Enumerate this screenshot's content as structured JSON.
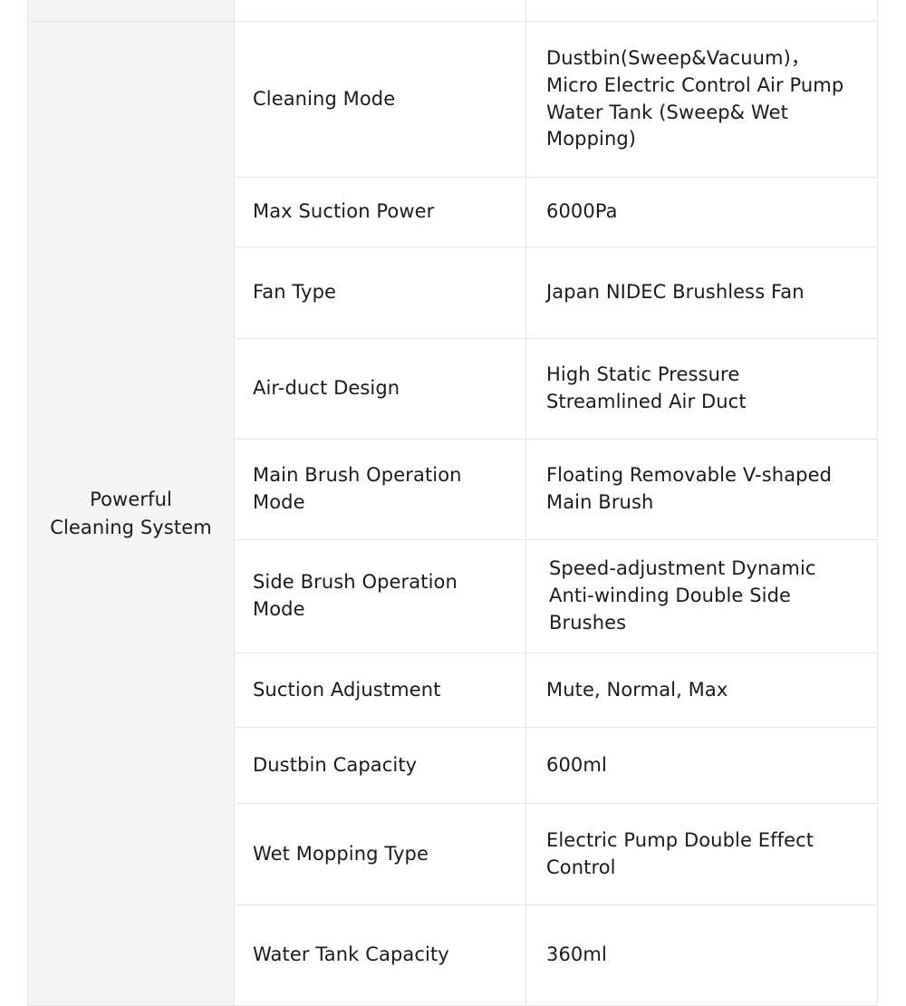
{
  "table": {
    "category": {
      "label": "Powerful\nCleaning System",
      "line1": "Powerful",
      "line2": "Cleaning System"
    },
    "rows": [
      {
        "label": "Cleaning Mode",
        "value": "Dustbin(Sweep&Vacuum)，Micro Electric Control Air Pump Water Tank (Sweep& Wet Mopping)"
      },
      {
        "label": "Max Suction Power",
        "value": "6000Pa"
      },
      {
        "label": "Fan Type",
        "value": "Japan NIDEC Brushless Fan"
      },
      {
        "label": "Air-duct Design",
        "value": "High Static Pressure Streamlined Air Duct"
      },
      {
        "label": "Main Brush Operation Mode",
        "value": "Floating Removable V-shaped Main Brush"
      },
      {
        "label": "Side Brush Operation Mode",
        "value": "Speed-adjustment Dynamic Anti-winding Double Side Brushes"
      },
      {
        "label": "Suction Adjustment",
        "value": "Mute, Normal, Max"
      },
      {
        "label": "Dustbin Capacity",
        "value": "600ml"
      },
      {
        "label": "Wet Mopping Type",
        "value": "Electric Pump Double Effect Control"
      },
      {
        "label": "Water Tank Capacity",
        "value": "360ml"
      }
    ],
    "previous_row": {
      "label": "",
      "value": ""
    }
  },
  "colors": {
    "category_background": "#f4f4f4",
    "cell_background": "#ffffff",
    "border": "#e6e6e6",
    "text": "#1b1b1b"
  }
}
